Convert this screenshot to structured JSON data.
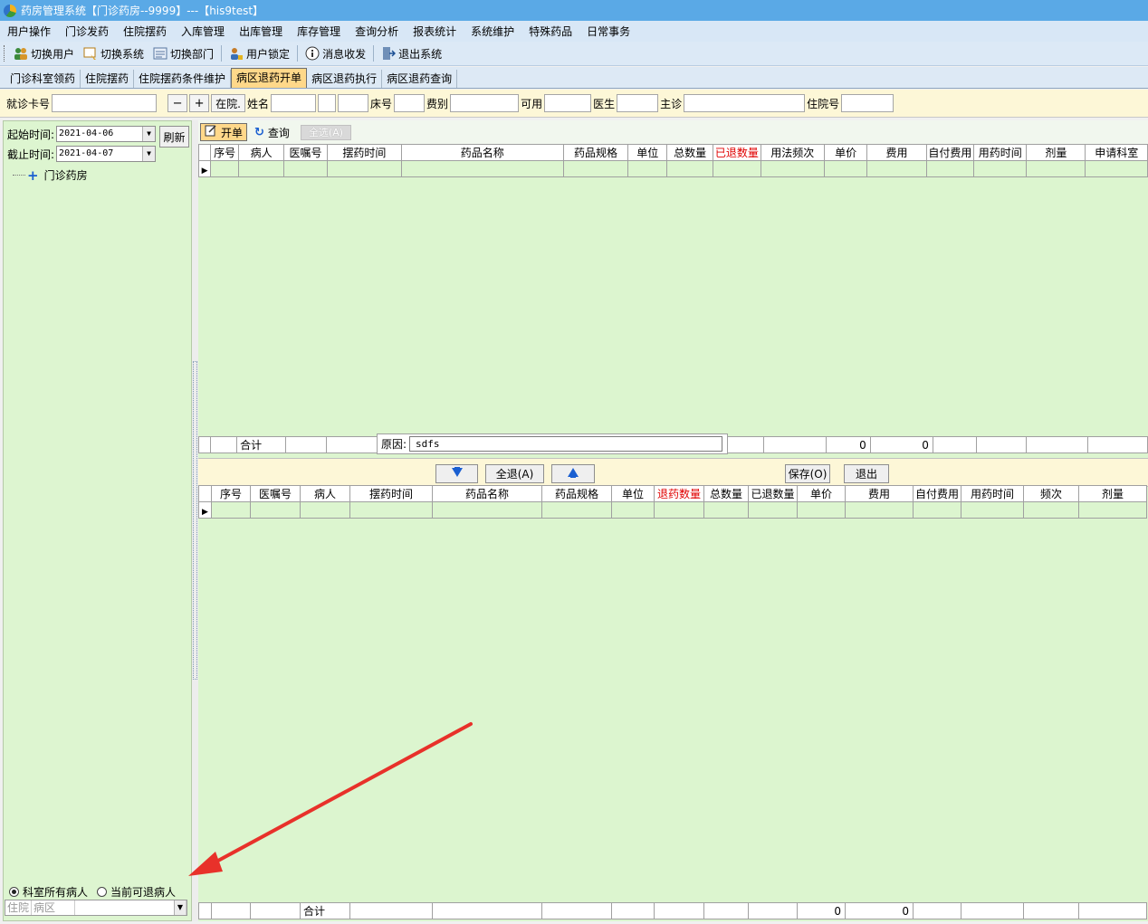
{
  "window": {
    "title": "药房管理系统【门诊药房--9999】---【his9test】"
  },
  "menu": [
    "用户操作",
    "门诊发药",
    "住院摆药",
    "入库管理",
    "出库管理",
    "库存管理",
    "查询分析",
    "报表统计",
    "系统维护",
    "特殊药品",
    "日常事务"
  ],
  "toolbar": [
    {
      "label": "切换用户",
      "icon": "users-icon"
    },
    {
      "label": "切换系统",
      "icon": "switch-system-icon"
    },
    {
      "label": "切换部门",
      "icon": "department-icon"
    },
    {
      "label": "用户锁定",
      "icon": "lock-user-icon"
    },
    {
      "label": "消息收发",
      "icon": "info-icon"
    },
    {
      "label": "退出系统",
      "icon": "exit-icon"
    }
  ],
  "tabs": [
    "门诊科室领药",
    "住院摆药",
    "住院摆药条件维护",
    "病区退药开单",
    "病区退药执行",
    "病区退药查询"
  ],
  "active_tab": 3,
  "filters": {
    "card_label": "就诊卡号",
    "minus": "−",
    "plus": "+",
    "inpatient_btn": "在院.",
    "name_label": "姓名",
    "bed_label": "床号",
    "fee_label": "费别",
    "available_label": "可用",
    "doctor_label": "医生",
    "attending_label": "主诊",
    "admission_label": "住院号"
  },
  "left": {
    "start_label": "起始时间:",
    "start_value": "2021-04-06",
    "end_label": "截止时间:",
    "end_value": "2021-04-07",
    "refresh": "刷新",
    "tree_root": "门诊药房",
    "radio_all": "科室所有病人",
    "radio_current": "当前可退病人",
    "combo_a": "住院",
    "combo_b": "病区"
  },
  "right_toolbar": {
    "open": "开单",
    "query": "查询",
    "select_all": "全选(A)"
  },
  "upper_grid": {
    "columns": [
      "序号",
      "病人",
      "医嘱号",
      "摆药时间",
      "药品名称",
      "药品规格",
      "单位",
      "总数量",
      "已退数量",
      "用法频次",
      "单价",
      "费用",
      "自付费用",
      "用药时间",
      "剂量",
      "申请科室"
    ],
    "red_column": "已退数量",
    "sum_label": "合计",
    "sum_fee": "0",
    "sum_selfpay": "0"
  },
  "reason": {
    "label": "原因:",
    "value": "sdfs"
  },
  "mid_buttons": {
    "return_all": "全退(A)",
    "save": "保存(O)",
    "exit": "退出"
  },
  "lower_grid": {
    "columns": [
      "序号",
      "医嘱号",
      "病人",
      "摆药时间",
      "药品名称",
      "药品规格",
      "单位",
      "退药数量",
      "总数量",
      "已退数量",
      "单价",
      "费用",
      "自付费用",
      "用药时间",
      "频次",
      "剂量"
    ],
    "red_column": "退药数量",
    "sum_label": "合计",
    "sum_fee": "0",
    "sum_selfpay": "0"
  },
  "colors": {
    "grid_bg": "#dcf5cf",
    "active_tab": "#ffd88a",
    "filter_bg": "#fdf7d7",
    "titlebar": "#5aa9e6",
    "annotation_arrow": "#e8312a"
  }
}
